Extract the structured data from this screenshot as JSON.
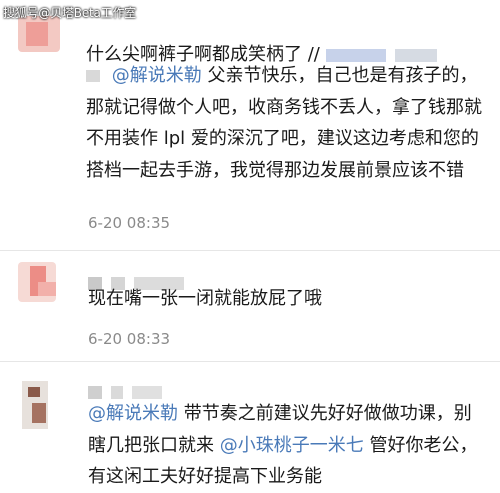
{
  "watermark": "搜狐号@贝塔Beta工作室",
  "comments": [
    {
      "header_text": "什么尖啊裤子啊都成笑柄了 //",
      "segments": [
        {
          "type": "mention",
          "text": "@解说米勒"
        },
        {
          "type": "text",
          "text": " 父亲节快乐，自己也是有孩子的，那就记得做个人吧，收商务钱不丢人，拿了钱那就不用装作 lpl 爱的深沉了吧，建议这边考虑和您的搭档一起去手游，我觉得那边发展前景应该不错"
        }
      ],
      "time": "6-20 08:35"
    },
    {
      "header_text": "",
      "segments": [
        {
          "type": "text",
          "text": "现在嘴一张一闭就能放屁了哦"
        }
      ],
      "time": "6-20 08:33"
    },
    {
      "header_text": "",
      "segments": [
        {
          "type": "mention",
          "text": "@解说米勒"
        },
        {
          "type": "text",
          "text": " 带节奏之前建议先好好做做功课，别瞎几把张口就来 "
        },
        {
          "type": "mention",
          "text": "@小珠桃子一米七"
        },
        {
          "type": "text",
          "text": "管好你老公，有这闲工夫好好提高下业务能"
        }
      ],
      "time": ""
    }
  ],
  "colors": {
    "mention": "#4a7ab8",
    "time": "#8a8a8a",
    "text": "#1a1a1a",
    "divider": "#e6e6e6"
  }
}
